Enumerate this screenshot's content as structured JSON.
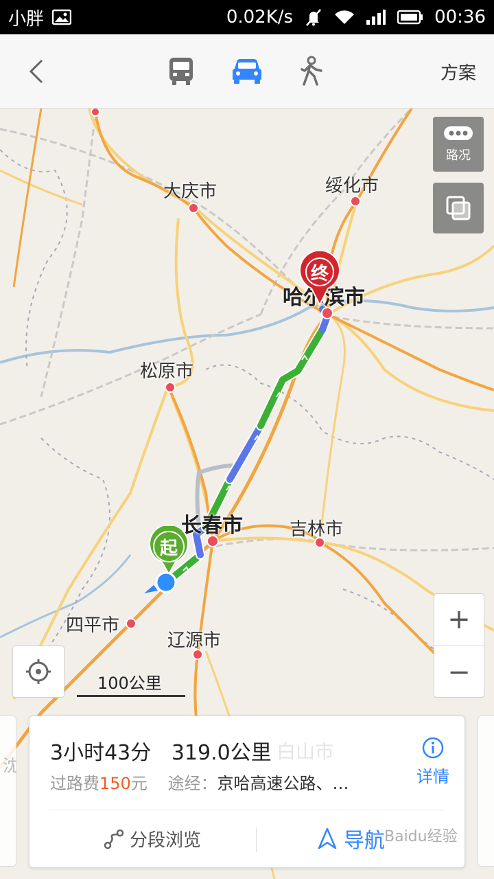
{
  "status_bar": {
    "carrier": "小胖",
    "speed": "0.02K/s",
    "time": "00:36"
  },
  "nav": {
    "modes": [
      {
        "name": "bus",
        "icon": "bus-icon"
      },
      {
        "name": "car",
        "icon": "car-icon",
        "selected": true
      },
      {
        "name": "walk",
        "icon": "walk-icon"
      }
    ],
    "plan_label": "方案",
    "accent_color": "#3385ff"
  },
  "map": {
    "cities": {
      "daqing": "大庆市",
      "suihua": "绥化市",
      "harbin": "哈尔滨市",
      "songyuan": "松原市",
      "changchun": "长春市",
      "jilin": "吉林市",
      "siping": "四平市",
      "liaoyuan": "辽源市",
      "shenyang": "沈阳市",
      "baishan": "白山市"
    },
    "start_marker": "起",
    "end_marker": "终",
    "traffic_label": "路况",
    "scale_label": "100公里",
    "zoom_in": "+",
    "zoom_out": "−"
  },
  "route": {
    "duration": "3小时43分",
    "distance": "319.0公里",
    "toll_label": "过路费",
    "toll_amount": "150",
    "toll_unit": "元",
    "via_label": "途经：",
    "via_value": "京哈高速公路、…",
    "details_label": "详情",
    "segments_label": "分段浏览",
    "navigate_label": "导航"
  },
  "watermark": "Baidu经验"
}
